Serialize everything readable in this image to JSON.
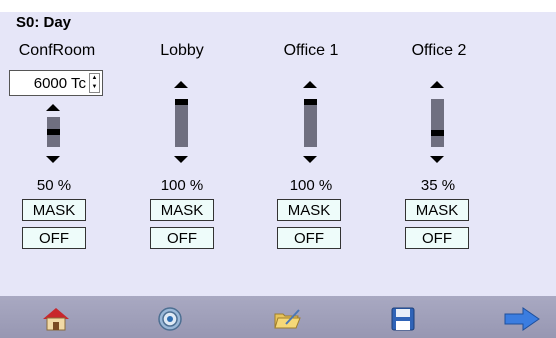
{
  "title": "S0: Day",
  "zones": [
    {
      "name": "ConfRoom",
      "level_pct": 50,
      "level_label": "50 %",
      "mask_label": "MASK",
      "off_label": "OFF"
    },
    {
      "name": "Lobby",
      "level_pct": 100,
      "level_label": "100 %",
      "mask_label": "MASK",
      "off_label": "OFF"
    },
    {
      "name": "Office 1",
      "level_pct": 100,
      "level_label": "100 %",
      "mask_label": "MASK",
      "off_label": "OFF"
    },
    {
      "name": "Office 2",
      "level_pct": 35,
      "level_label": "35 %",
      "mask_label": "MASK",
      "off_label": "OFF"
    }
  ],
  "color_temp": {
    "value": "6000 Tc"
  },
  "nav": {
    "icons": [
      "home-icon",
      "gear-icon",
      "folder-icon",
      "save-icon",
      "arrow-right-icon"
    ]
  },
  "colors": {
    "background": "#e6e6f8",
    "track": "#6f6f80",
    "button_fill": "#eefcfa",
    "bottom_bar": "#a1a1bc"
  }
}
